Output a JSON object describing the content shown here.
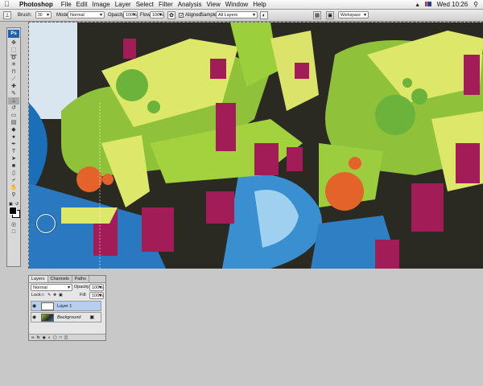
{
  "menubar": {
    "app": "Photoshop",
    "items": [
      "File",
      "Edit",
      "Image",
      "Layer",
      "Select",
      "Filter",
      "Analysis",
      "View",
      "Window",
      "Help"
    ],
    "clock": "Wed 10:26"
  },
  "options": {
    "brush_label": "Brush:",
    "brush_size": "30",
    "mode_label": "Mode:",
    "mode_value": "Normal",
    "opacity_label": "Opacity:",
    "opacity_value": "100%",
    "flow_label": "Flow:",
    "flow_value": "100%",
    "aligned_label": "Aligned",
    "sample_label": "Sample:",
    "sample_value": "All Layers",
    "workspace_label": "Workspace"
  },
  "toolbox": {
    "logo": "Ps",
    "tools": [
      {
        "icon": "move-icon",
        "glyph": "✥"
      },
      {
        "icon": "marquee-icon",
        "glyph": "⬚"
      },
      {
        "icon": "lasso-icon",
        "glyph": "➰"
      },
      {
        "icon": "magic-wand-icon",
        "glyph": "✳"
      },
      {
        "icon": "crop-icon",
        "glyph": "⊓"
      },
      {
        "icon": "slice-icon",
        "glyph": "⟋"
      },
      {
        "icon": "healing-brush-icon",
        "glyph": "✚"
      },
      {
        "icon": "brush-icon",
        "glyph": "✎"
      },
      {
        "icon": "clone-stamp-icon",
        "glyph": "⊥"
      },
      {
        "icon": "history-brush-icon",
        "glyph": "↺"
      },
      {
        "icon": "eraser-icon",
        "glyph": "▭"
      },
      {
        "icon": "gradient-icon",
        "glyph": "▤"
      },
      {
        "icon": "blur-icon",
        "glyph": "◆"
      },
      {
        "icon": "dodge-icon",
        "glyph": "●"
      },
      {
        "icon": "pen-icon",
        "glyph": "✒"
      },
      {
        "icon": "type-icon",
        "glyph": "T"
      },
      {
        "icon": "path-selection-icon",
        "glyph": "➤"
      },
      {
        "icon": "shape-icon",
        "glyph": "■"
      },
      {
        "icon": "notes-icon",
        "glyph": "▯"
      },
      {
        "icon": "eyedropper-icon",
        "glyph": "⌿"
      },
      {
        "icon": "hand-icon",
        "glyph": "✋"
      },
      {
        "icon": "zoom-icon",
        "glyph": "⚲"
      }
    ],
    "active_index": 8
  },
  "layers_panel": {
    "tabs": [
      "Layers",
      "Channels",
      "Paths"
    ],
    "blend_mode": "Normal",
    "opacity_label": "Opacity:",
    "opacity_value": "100%",
    "lock_label": "Lock:",
    "fill_label": "Fill:",
    "fill_value": "100%",
    "layers": [
      {
        "name": "Layer 1",
        "selected": true,
        "visible": true
      },
      {
        "name": "Background",
        "selected": false,
        "visible": true,
        "locked": true
      }
    ],
    "footer_icons": [
      "link-icon",
      "fx-icon",
      "mask-icon",
      "adjustment-icon",
      "group-icon",
      "new-layer-icon",
      "trash-icon"
    ]
  },
  "colors": {
    "foreground": "#000000",
    "background": "#ffffff",
    "accent": "#1f5fb0"
  }
}
